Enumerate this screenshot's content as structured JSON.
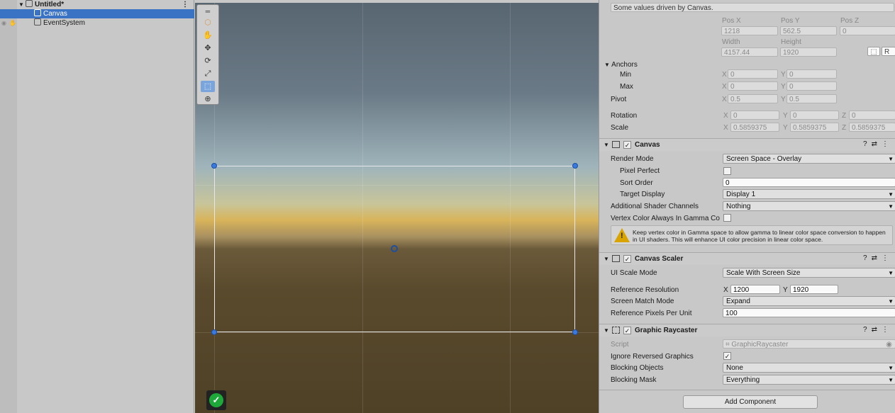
{
  "hierarchy": {
    "scene_name": "Untitled*",
    "items": [
      {
        "label": "Canvas",
        "selected": true
      },
      {
        "label": "EventSystem",
        "selected": false
      }
    ]
  },
  "scene_view": {
    "tools": [
      "hand-tool",
      "move-tool",
      "rotate-tool",
      "scale-tool",
      "rect-tool",
      "transform-tool"
    ],
    "active_tool": "rect-tool"
  },
  "inspector": {
    "driven_note": "Some values driven by Canvas.",
    "transform": {
      "labels": {
        "pos_x": "Pos X",
        "pos_y": "Pos Y",
        "pos_z": "Pos Z",
        "width": "Width",
        "height": "Height"
      },
      "pos_x": "1218",
      "pos_y": "562.5",
      "pos_z": "0",
      "width": "4157.44",
      "height": "1920",
      "r_button": "R",
      "anchors_label": "Anchors",
      "min_label": "Min",
      "min_x": "0",
      "min_y": "0",
      "max_label": "Max",
      "max_x": "0",
      "max_y": "0",
      "pivot_label": "Pivot",
      "pivot_x": "0.5",
      "pivot_y": "0.5",
      "rotation_label": "Rotation",
      "rot_x": "0",
      "rot_y": "0",
      "rot_z": "0",
      "scale_label": "Scale",
      "scale_x": "0.5859375",
      "scale_y": "0.5859375",
      "scale_z": "0.5859375",
      "axis_x": "X",
      "axis_y": "Y",
      "axis_z": "Z"
    },
    "canvas": {
      "title": "Canvas",
      "render_mode_label": "Render Mode",
      "render_mode": "Screen Space - Overlay",
      "pixel_perfect_label": "Pixel Perfect",
      "sort_order_label": "Sort Order",
      "sort_order": "0",
      "target_display_label": "Target Display",
      "target_display": "Display 1",
      "shader_channels_label": "Additional Shader Channels",
      "shader_channels": "Nothing",
      "vertex_color_label": "Vertex Color Always In Gamma Co",
      "warning": "Keep vertex color in Gamma space to allow gamma to linear color space conversion to happen in UI shaders. This will enhance UI color precision in linear color space."
    },
    "canvas_scaler": {
      "title": "Canvas Scaler",
      "ui_scale_mode_label": "UI Scale Mode",
      "ui_scale_mode": "Scale With Screen Size",
      "ref_res_label": "Reference Resolution",
      "ref_res_x": "1200",
      "ref_res_y": "1920",
      "match_mode_label": "Screen Match Mode",
      "match_mode": "Expand",
      "ref_ppu_label": "Reference Pixels Per Unit",
      "ref_ppu": "100"
    },
    "graphic_raycaster": {
      "title": "Graphic Raycaster",
      "script_label": "Script",
      "script": "GraphicRaycaster",
      "ignore_reversed_label": "Ignore Reversed Graphics",
      "blocking_objects_label": "Blocking Objects",
      "blocking_objects": "None",
      "blocking_mask_label": "Blocking Mask",
      "blocking_mask": "Everything"
    },
    "add_component": "Add Component"
  },
  "colors": {
    "selection": "#3a72c4",
    "handle": "#3a7ae0",
    "ok": "#1ea83a",
    "warning": "#d9a400"
  }
}
